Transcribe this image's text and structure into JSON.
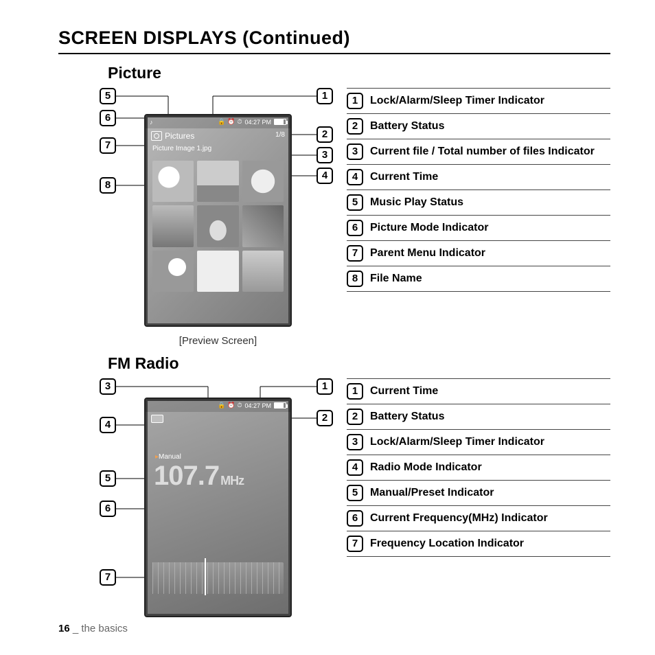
{
  "page": {
    "title": "SCREEN DISPLAYS (Continued)",
    "footer_page": "16",
    "footer_sep": " _ ",
    "footer_section": "the basics"
  },
  "picture": {
    "heading": "Picture",
    "caption": "[Preview Screen]",
    "device": {
      "time": "04:27 PM",
      "counter": "1/8",
      "mode_label": "Pictures",
      "filename": "Picture Image 1.jpg"
    },
    "callouts_left": [
      "5",
      "6",
      "7",
      "8"
    ],
    "callouts_right": [
      "1",
      "2",
      "3",
      "4"
    ],
    "legend": [
      {
        "n": "1",
        "t": "Lock/Alarm/Sleep Timer Indicator"
      },
      {
        "n": "2",
        "t": "Battery Status"
      },
      {
        "n": "3",
        "t": "Current file / Total number of files Indicator"
      },
      {
        "n": "4",
        "t": "Current Time"
      },
      {
        "n": "5",
        "t": "Music Play Status"
      },
      {
        "n": "6",
        "t": "Picture Mode Indicator"
      },
      {
        "n": "7",
        "t": "Parent Menu Indicator"
      },
      {
        "n": "8",
        "t": "File Name"
      }
    ]
  },
  "fm": {
    "heading": "FM Radio",
    "device": {
      "time": "04:27 PM",
      "mode_label": "Manual",
      "frequency": "107.7",
      "unit": "MHz"
    },
    "callouts_left": [
      "3",
      "4",
      "5",
      "6",
      "7"
    ],
    "callouts_right": [
      "1",
      "2"
    ],
    "legend": [
      {
        "n": "1",
        "t": "Current Time"
      },
      {
        "n": "2",
        "t": "Battery Status"
      },
      {
        "n": "3",
        "t": "Lock/Alarm/Sleep Timer Indicator"
      },
      {
        "n": "4",
        "t": "Radio Mode Indicator"
      },
      {
        "n": "5",
        "t": "Manual/Preset Indicator"
      },
      {
        "n": "6",
        "t": "Current Frequency(MHz) Indicator"
      },
      {
        "n": "7",
        "t": "Frequency Location Indicator"
      }
    ]
  }
}
